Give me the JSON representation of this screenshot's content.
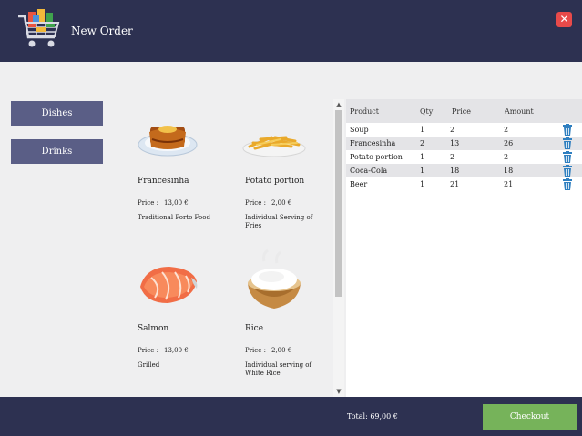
{
  "header": {
    "title": "New Order",
    "close_label": "✕"
  },
  "categories": [
    {
      "label": "Dishes"
    },
    {
      "label": "Drinks"
    }
  ],
  "products": [
    {
      "name": "Francesinha",
      "price_label": "Price :",
      "price": "13,00 €",
      "description": "Traditional Porto Food",
      "icon": "francesinha-image"
    },
    {
      "name": "Potato portion",
      "price_label": "Price :",
      "price": "2,00 €",
      "description": "Individual Serving of Fries",
      "icon": "fries-image"
    },
    {
      "name": "Salmon",
      "price_label": "Price :",
      "price": "13,00 €",
      "description": "Grilled",
      "icon": "salmon-image"
    },
    {
      "name": "Rice",
      "price_label": "Price :",
      "price": "2,00 €",
      "description": "Individual serving of White Rice",
      "icon": "rice-image"
    }
  ],
  "order": {
    "columns": {
      "product": "Product",
      "qty": "Qty",
      "price": "Price",
      "amount": "Amount"
    },
    "rows": [
      {
        "product": "Soup",
        "qty": "1",
        "price": "2",
        "amount": "2"
      },
      {
        "product": "Francesinha",
        "qty": "2",
        "price": "13",
        "amount": "26"
      },
      {
        "product": "Potato portion",
        "qty": "1",
        "price": "2",
        "amount": "2"
      },
      {
        "product": "Coca-Cola",
        "qty": "1",
        "price": "18",
        "amount": "18"
      },
      {
        "product": "Beer",
        "qty": "1",
        "price": "21",
        "amount": "21"
      }
    ]
  },
  "footer": {
    "total": "Total: 69,00 €",
    "checkout_label": "Checkout"
  },
  "colors": {
    "header_bg": "#2d3151",
    "category_button": "#5a5e86",
    "checkout": "#76b35a",
    "close": "#e84a4a",
    "trash": "#2f7fc0"
  }
}
